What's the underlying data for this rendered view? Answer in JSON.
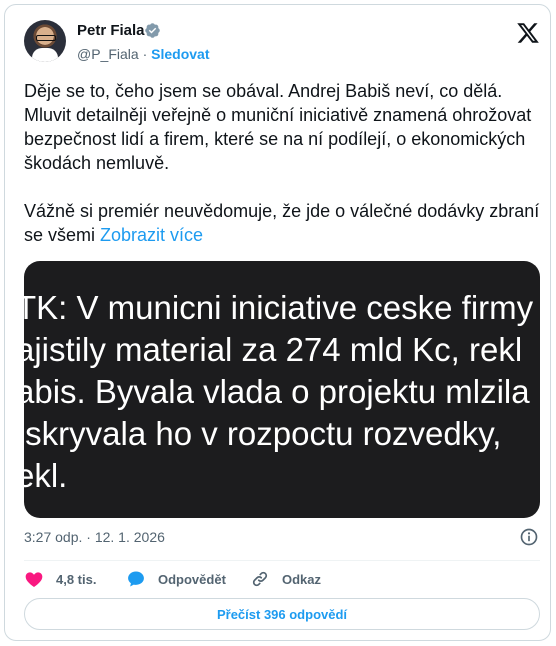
{
  "author": {
    "name": "Petr Fiala",
    "handle": "@P_Fiala",
    "separator": "·",
    "follow_label": "Sledovat"
  },
  "tweet": {
    "paragraph1": "Děje se to, čeho jsem se obával. Andrej Babiš neví, co dělá. Mluvit detailněji veřejně o muniční iniciativě znamená ohrožovat bezpečnost lidí a firem, které se na ní podílejí, o ekonomických škodách nemluvě.",
    "paragraph2": "Vážně si premiér neuvědomuje, že jde o válečné dodávky zbraní se všemi",
    "show_more": "Zobrazit více"
  },
  "media": {
    "text": "TK: V municni iniciative ceske firmy\najistily material za 274 mld Kc, rekl\nabis. Byvala vlada o projektu mlzila\n skryvala ho v rozpoctu rozvedky,\nekl."
  },
  "meta": {
    "timestamp": "3:27 odp. · 12. 1. 2026"
  },
  "actions": {
    "likes": "4,8 tis.",
    "reply_label": "Odpovědět",
    "link_label": "Odkaz"
  },
  "read_replies": "Přečíst 396 odpovědí",
  "colors": {
    "accent": "#1d9bf0",
    "like": "#f91880",
    "muted": "#536471"
  },
  "icons": {
    "verified": "verified-badge-icon",
    "platform": "x-logo-icon",
    "info": "info-icon",
    "like": "heart-icon",
    "reply": "chat-bubble-icon",
    "link": "link-icon"
  }
}
